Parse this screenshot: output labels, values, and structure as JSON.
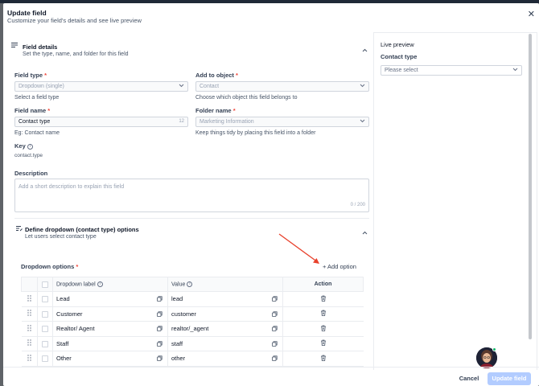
{
  "modal": {
    "title": "Update field",
    "subtitle": "Customize your field's details and see live preview",
    "close": "✕"
  },
  "field_details": {
    "title": "Field details",
    "subtitle": "Set the type, name, and folder for this field",
    "field_type": {
      "label": "Field type",
      "required": "*",
      "value": "Dropdown (single)",
      "help": "Select a field type"
    },
    "add_to_object": {
      "label": "Add to object",
      "required": "*",
      "value": "Contact",
      "help": "Choose which object this field belongs to"
    },
    "field_name": {
      "label": "Field name",
      "required": "*",
      "value": "Contact type",
      "count": "12",
      "help": "Eg: Contact name"
    },
    "folder_name": {
      "label": "Folder name",
      "required": "*",
      "value": "Marketing Information",
      "help": "Keep things tidy by placing this field into a folder"
    },
    "key": {
      "label": "Key",
      "value": "contact.type"
    },
    "description": {
      "label": "Description",
      "placeholder": "Add a short description to explain this field",
      "count": "0 / 200"
    }
  },
  "dropdown_section": {
    "title": "Define dropdown (contact type) options",
    "subtitle": "Let users select contact type",
    "options_label": "Dropdown options",
    "required": "*",
    "add_option": "+ Add option",
    "columns": {
      "label": "Dropdown label",
      "value": "Value",
      "action": "Action"
    },
    "rows": [
      {
        "label": "Lead",
        "value": "lead"
      },
      {
        "label": "Customer",
        "value": "customer"
      },
      {
        "label": "Realtor/ Agent",
        "value": "realtor/_agent"
      },
      {
        "label": "Staff",
        "value": "staff"
      },
      {
        "label": "Other",
        "value": "other"
      }
    ]
  },
  "live_preview": {
    "title": "Live preview",
    "field_label": "Contact type",
    "placeholder": "Please select"
  },
  "footer": {
    "cancel": "Cancel",
    "update": "Update field"
  },
  "colors": {
    "annotation_arrow": "#e8412c",
    "primary_disabled": "#b2ccff",
    "required": "#f04438"
  },
  "icons": [
    "close-icon",
    "list-icon",
    "chevron-up-icon",
    "chevron-down-icon",
    "info-icon",
    "copy-icon",
    "trash-icon",
    "drag-handle-icon"
  ]
}
